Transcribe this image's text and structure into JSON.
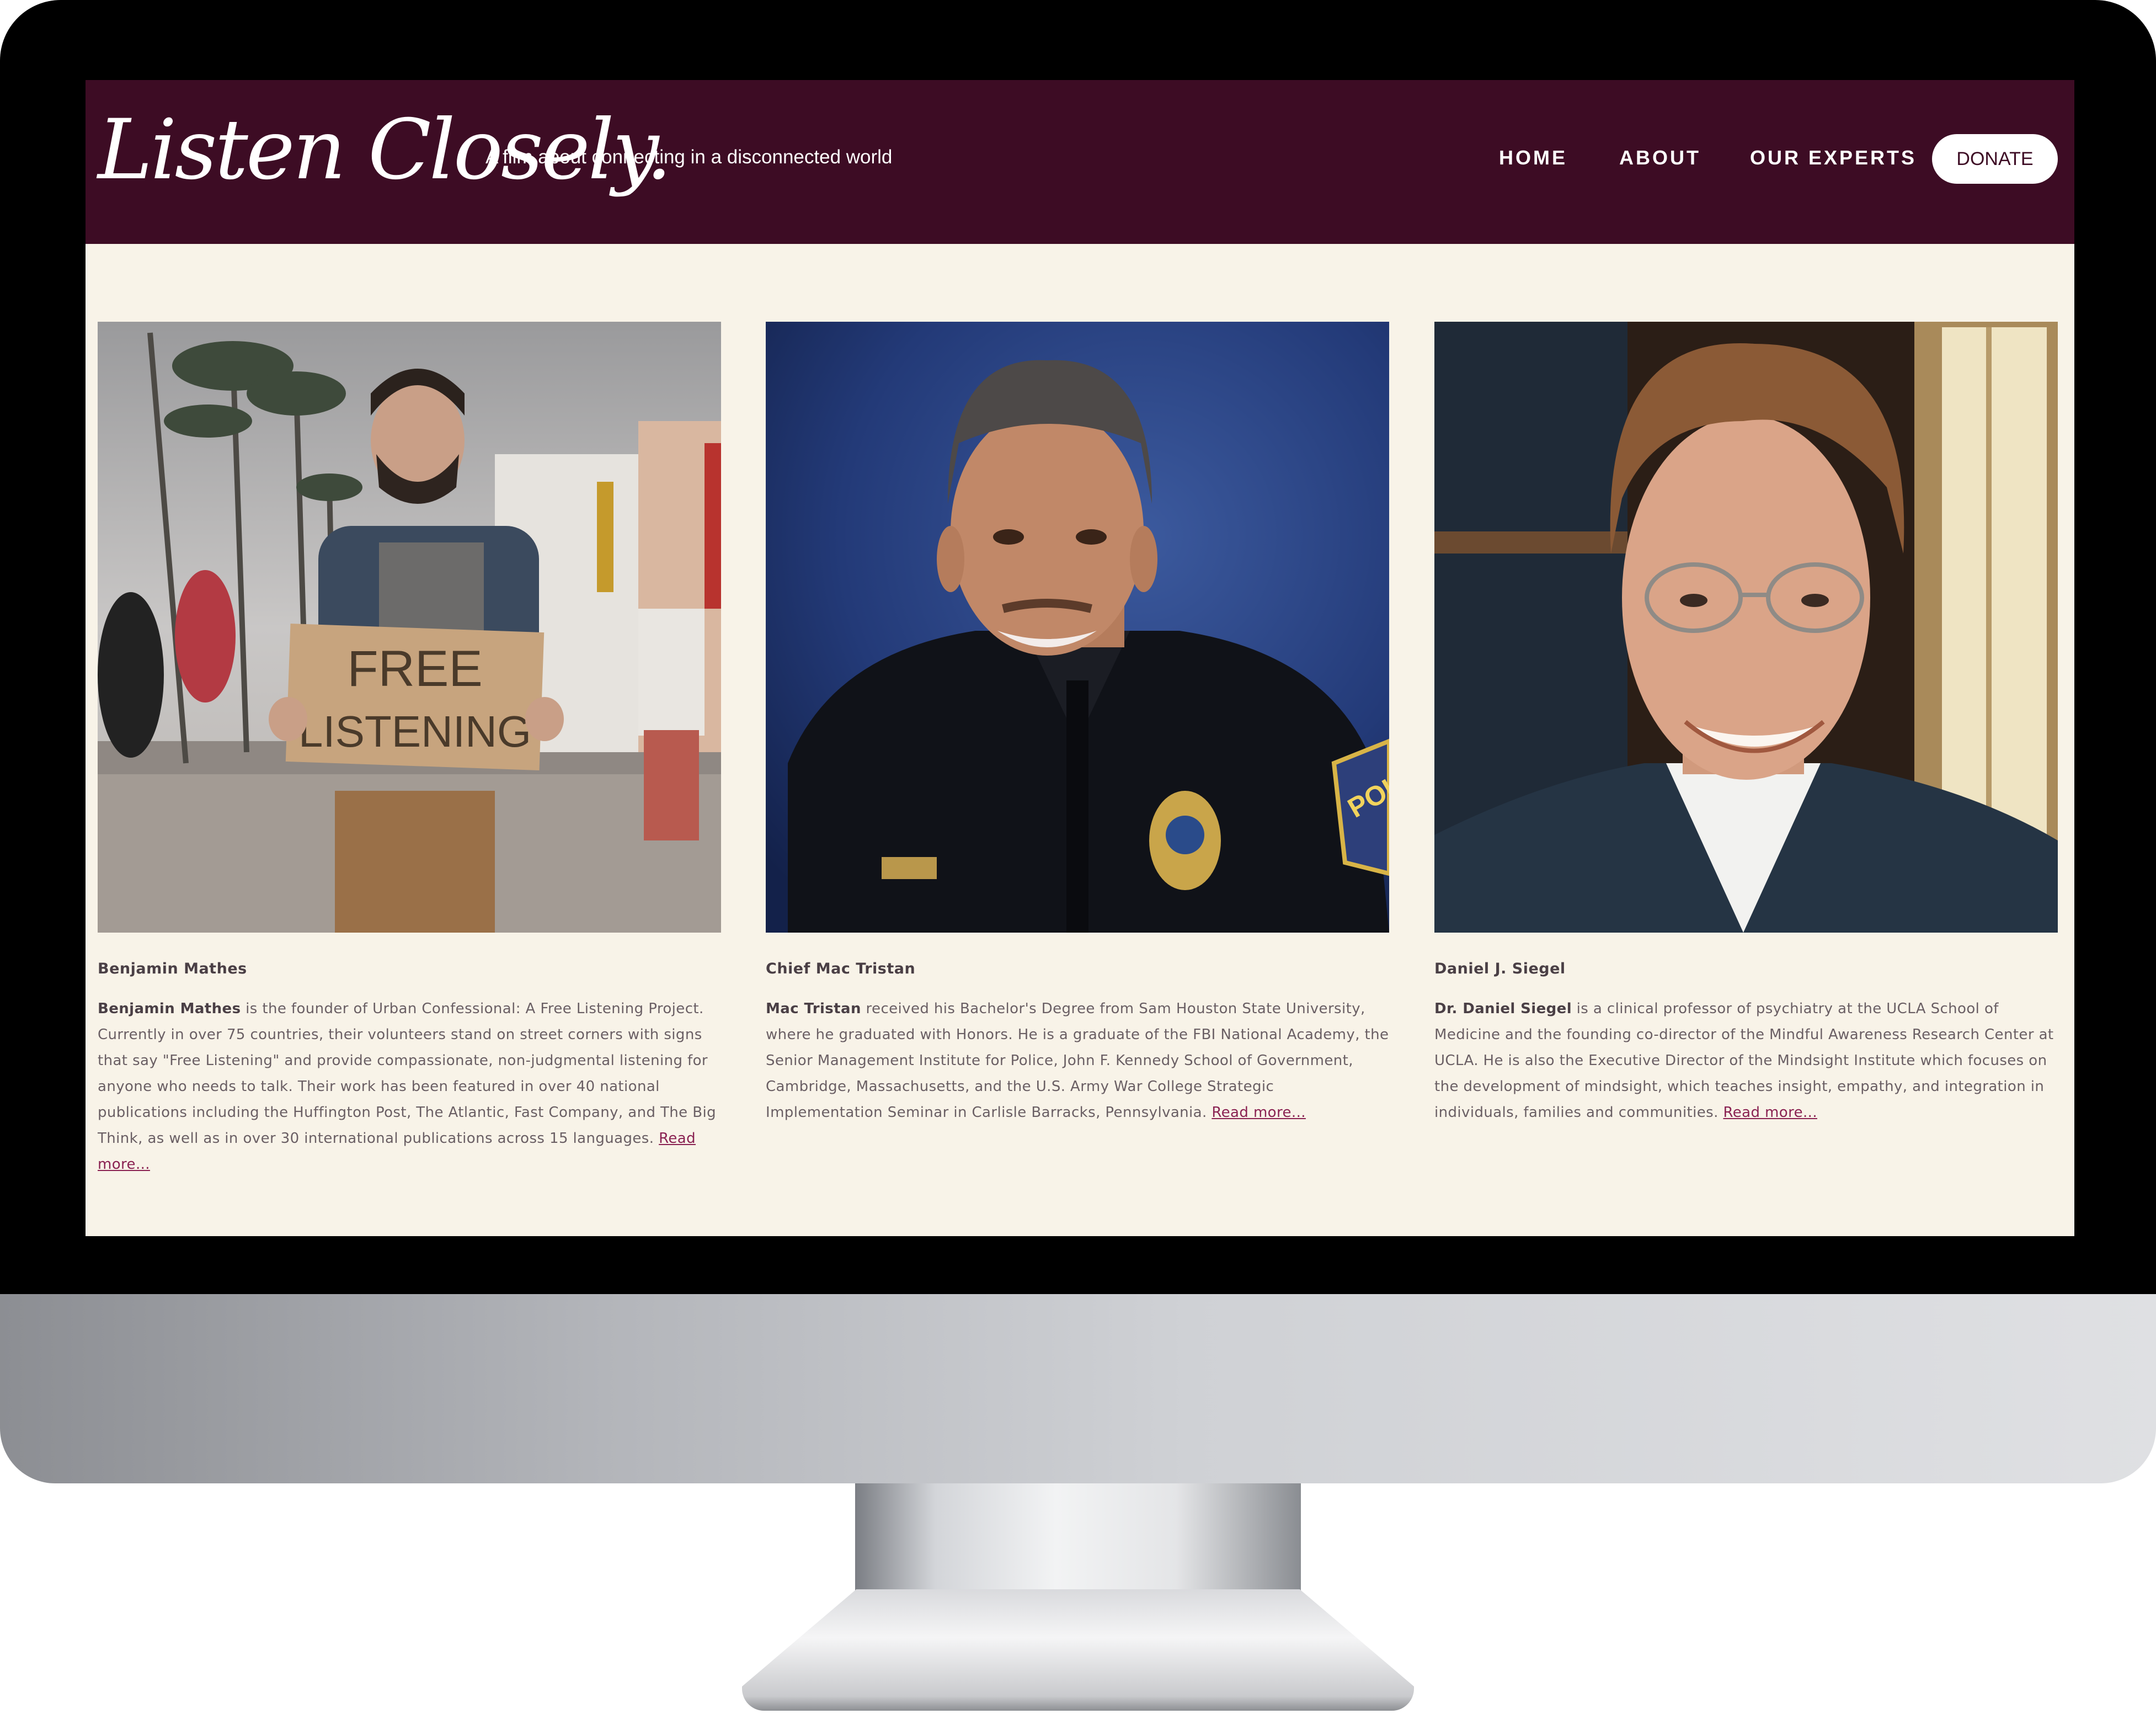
{
  "header": {
    "logo": "Listen Closely.",
    "tagline": "A film about connecting in a disconnected world",
    "nav": {
      "home": "HOME",
      "about": "ABOUT",
      "our_experts": "OUR EXPERTS",
      "donate": "DONATE"
    }
  },
  "experts": [
    {
      "name": "Benjamin Mathes",
      "bio_bold": "Benjamin Mathes",
      "bio_text": " is the founder of Urban Confessional: A Free Listening Project. Currently in over 75 countries, their volunteers stand on street corners with signs that say \"Free Listening\" and provide compassionate, non-judgmental listening for anyone who needs to talk. Their work has been featured in over 40 national publications including the Huffington Post, The Atlantic, Fast Company, and The Big Think, as well as in over 30 international publications across 15 languages. ",
      "read_more": "Read more...",
      "photo_sign": "FREE LISTENING"
    },
    {
      "name": "Chief Mac Tristan",
      "bio_bold": "Mac Tristan",
      "bio_text": " received his Bachelor's Degree from Sam Houston State University, where he graduated with Honors. He is a graduate of the FBI National Academy, the Senior Management Institute for Police, John F. Kennedy School of Government, Cambridge, Massachusetts, and the U.S. Army War College Strategic Implementation Seminar in Carlisle Barracks, Pennsylvania. ",
      "read_more": "Read more...",
      "photo_patch": "POL"
    },
    {
      "name": "Daniel J. Siegel",
      "bio_bold": "Dr. Daniel Siegel",
      "bio_text": " is a clinical professor of psychiatry at the UCLA School of Medicine and the founding co-director of the Mindful Awareness Research Center at UCLA. He is also the Executive Director of the Mindsight Institute which focuses on the development of mindsight, which teaches insight, empathy, and integration in individuals, families and communities. ",
      "read_more": "Read more..."
    }
  ],
  "colors": {
    "header_bg": "#3d0c24",
    "page_bg": "#f8f3e8",
    "link": "#8a2252",
    "text": "#6a5f64"
  }
}
